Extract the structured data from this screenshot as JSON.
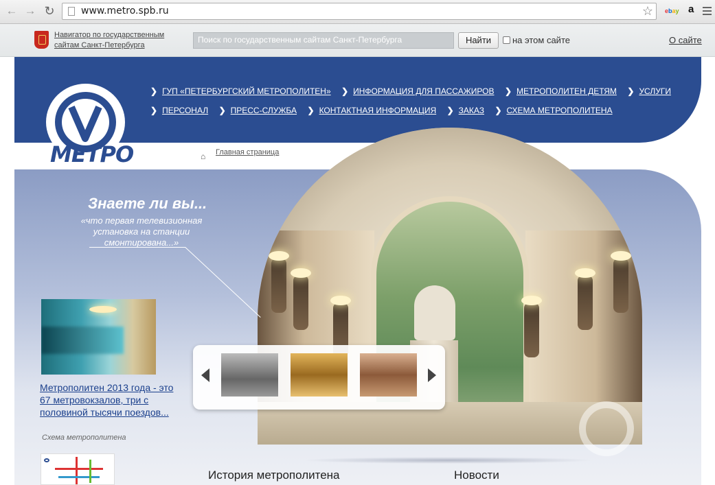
{
  "browser": {
    "url": "www.metro.spb.ru",
    "back_icon": "arrow-left-icon",
    "forward_icon": "arrow-right-icon",
    "reload_icon": "reload-icon",
    "ext_ebay": "ebay",
    "ext_amazon": "a"
  },
  "govbar": {
    "navigator_link": "Навигатор по государственным сайтам Санкт-Петербурга",
    "search_placeholder": "Поиск по государственным сайтам Санкт-Петербурга",
    "search_button": "Найти",
    "checkbox_label": "на этом сайте",
    "about_link": "О сайте"
  },
  "header": {
    "logo_text": "МЕТРО",
    "nav_row1": [
      {
        "label": "ГУП «ПЕТЕРБУРГСКИЙ МЕТРОПОЛИТЕН»"
      },
      {
        "label": "ИНФОРМАЦИЯ ДЛЯ ПАССАЖИРОВ"
      },
      {
        "label": "МЕТРОПОЛИТЕН ДЕТЯМ"
      },
      {
        "label": "УСЛУГИ"
      }
    ],
    "nav_row2": [
      {
        "label": "ПЕРСОНАЛ"
      },
      {
        "label": "ПРЕСС-СЛУЖБА"
      },
      {
        "label": "КОНТАКТНАЯ ИНФОРМАЦИЯ"
      },
      {
        "label": "ЗАКАЗ"
      },
      {
        "label": "СХЕМА МЕТРОПОЛИТЕНА"
      }
    ]
  },
  "breadcrumb": "Главная страница",
  "did_you_know": {
    "title": "Знаете ли вы...",
    "text": "«что первая телевизионная установка на станции смонтирована...»"
  },
  "news": {
    "link": "Метрополитен 2013 года - это 67 метровокзалов, три с половиной тысячи поездов..."
  },
  "scheme_label": "Схема метрополитена",
  "sections": {
    "history": "История метрополитена",
    "news": "Новости"
  },
  "colors": {
    "brand_blue": "#2b4d91",
    "link_blue": "#1a3f8c"
  }
}
